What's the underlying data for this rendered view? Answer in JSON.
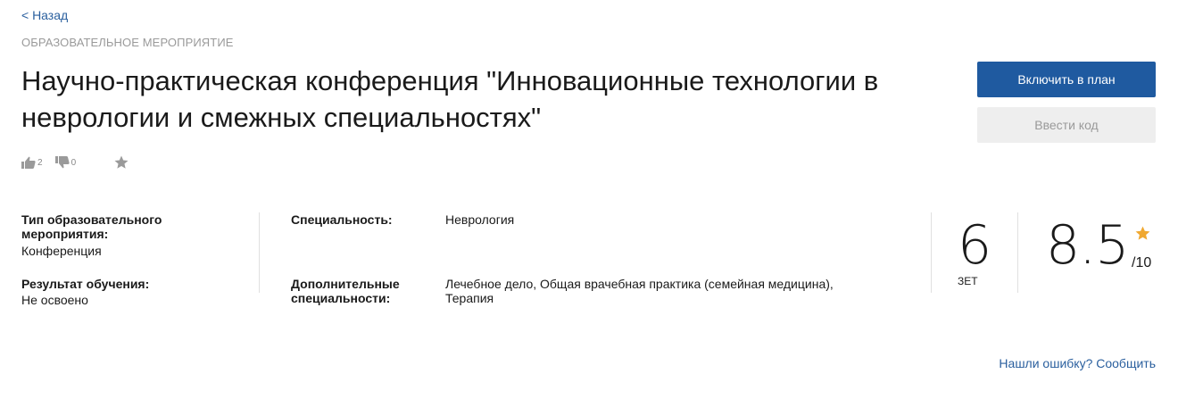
{
  "nav": {
    "back_label": "< Назад"
  },
  "event": {
    "category": "ОБРАЗОВАТЕЛЬНОЕ МЕРОПРИЯТИЕ",
    "title": "Научно-практическая конференция \"Инновационные технологии в неврологии и смежных специальностях\""
  },
  "actions": {
    "include_label": "Включить в план",
    "enter_code_label": "Ввести код"
  },
  "reactions": {
    "likes": "2",
    "dislikes": "0",
    "icons": {
      "like": "thumbs-up-icon",
      "dislike": "thumbs-down-icon",
      "favorite": "star-icon"
    }
  },
  "details": {
    "type_label": "Тип образовательного мероприятия:",
    "type_value": "Конференция",
    "result_label": "Результат обучения:",
    "result_value": "Не освоено",
    "specialty_label": "Специальность:",
    "specialty_value": "Неврология",
    "additional_label": "Дополнительные специальности:",
    "additional_value": "Лечебное дело, Общая врачебная практика (семейная медицина), Терапия"
  },
  "credits": {
    "value": "6",
    "unit": "ЗЕТ"
  },
  "rating": {
    "value": "8.5",
    "max": "/10",
    "star_color": "#f0a830"
  },
  "footer": {
    "report_label": "Нашли ошибку? Сообщить"
  },
  "colors": {
    "primary": "#1f5aa0",
    "link": "#2a5f9e",
    "muted": "#9a9a9a"
  }
}
